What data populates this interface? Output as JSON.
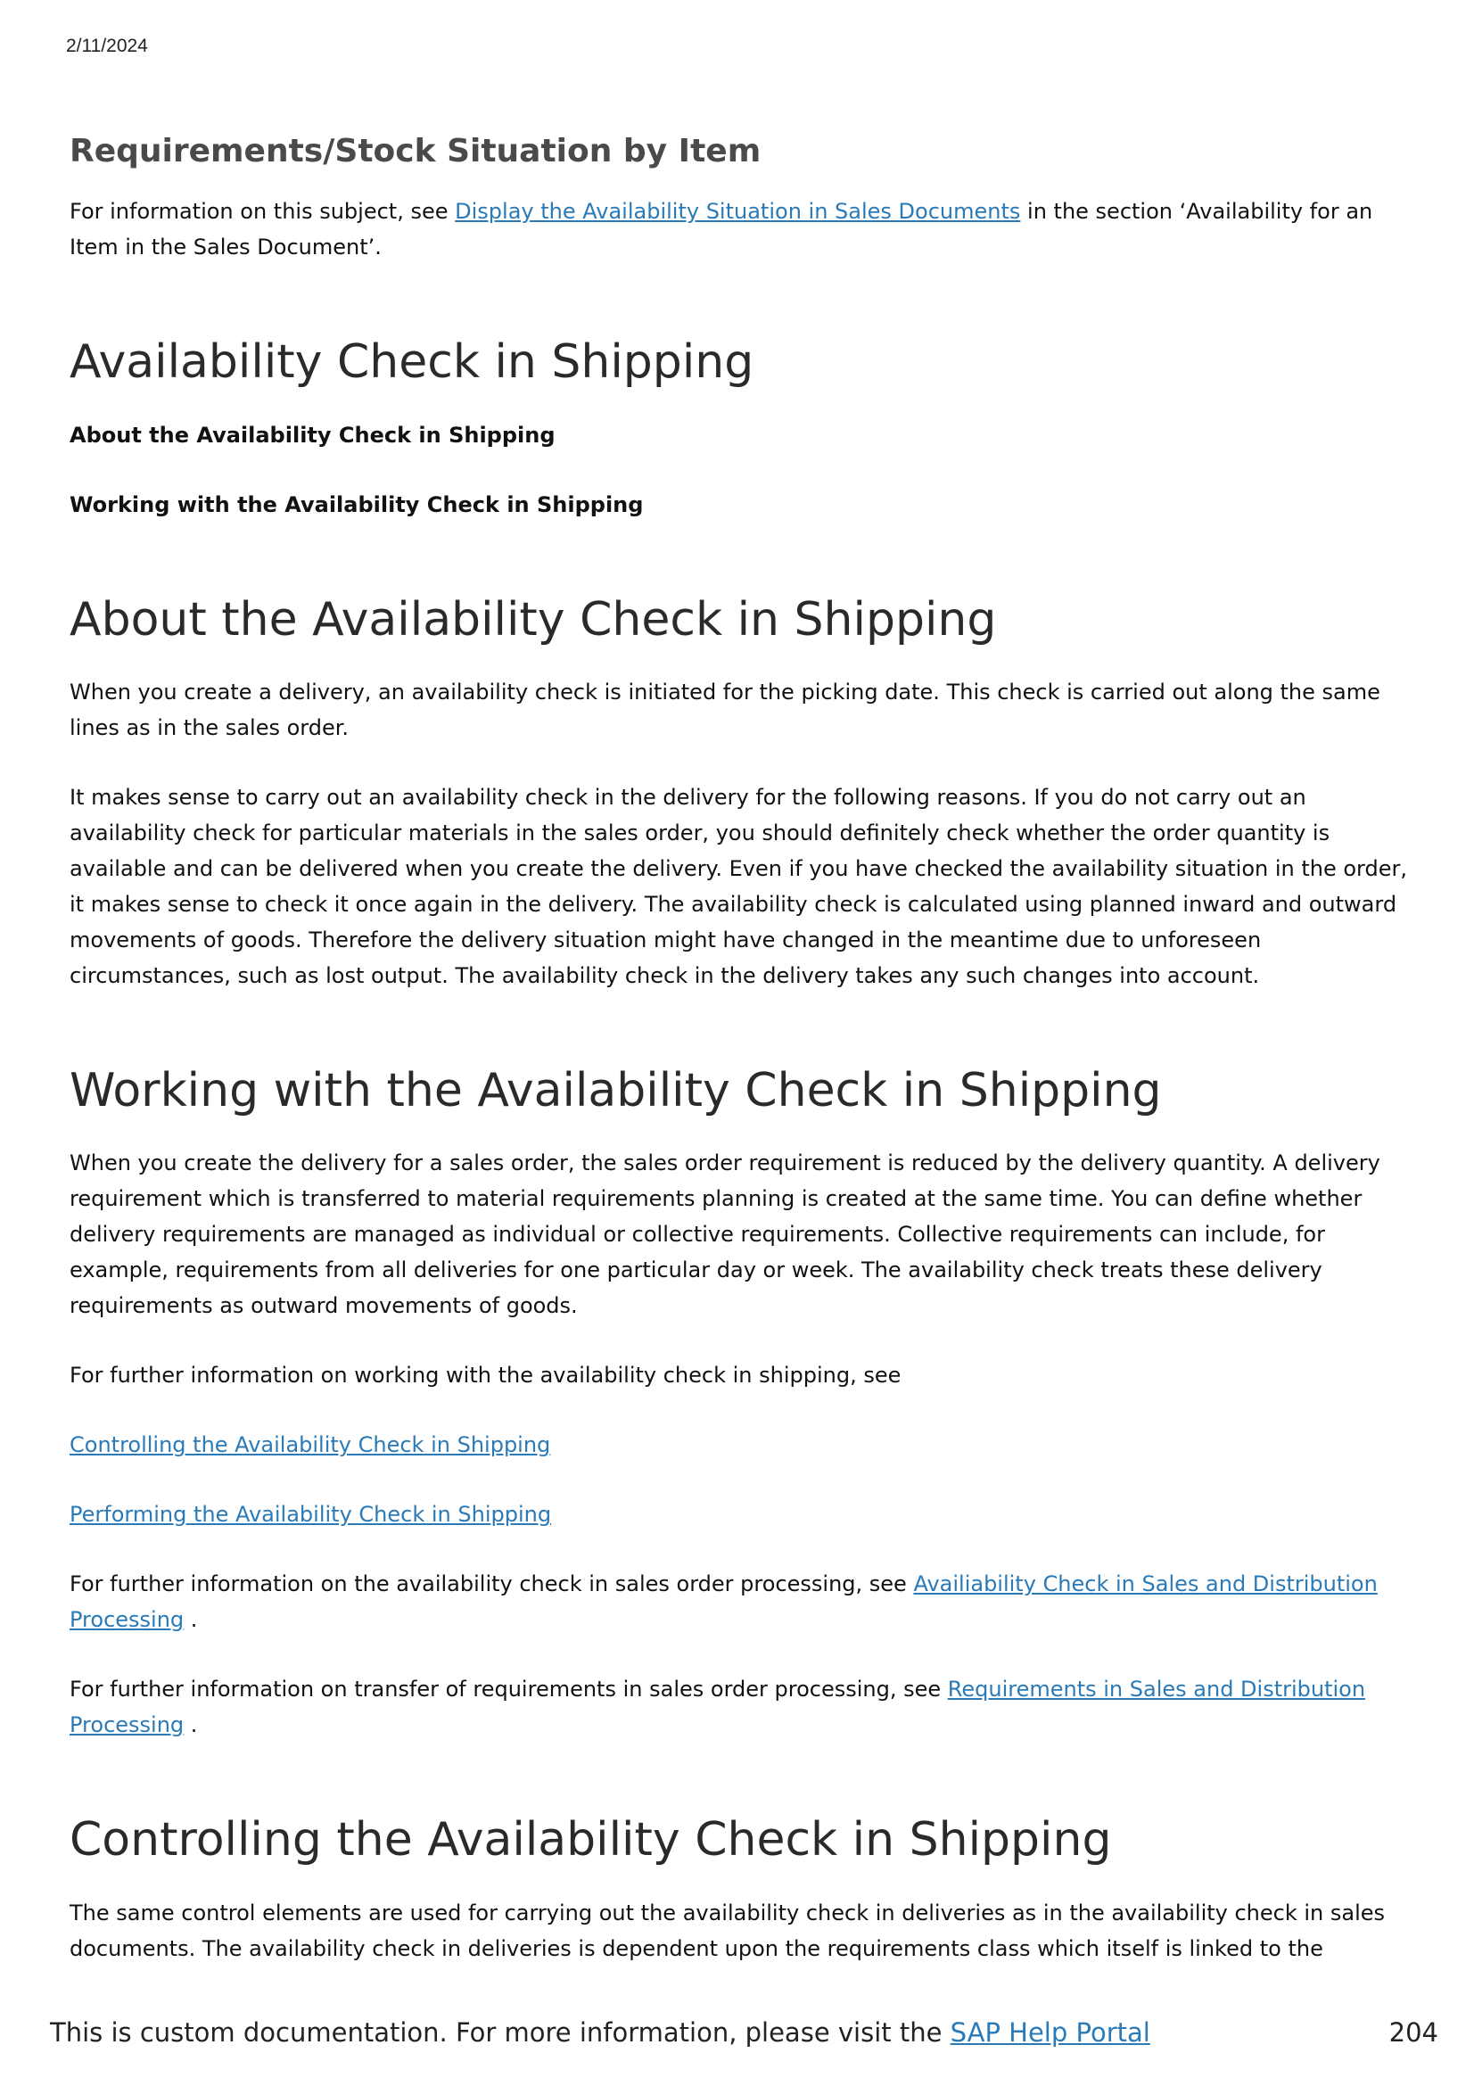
{
  "header": {
    "date": "2/11/2024"
  },
  "sections": {
    "req_stock": {
      "title": "Requirements/Stock Situation by Item",
      "p1_before": "For information on this subject, see ",
      "p1_link": "Display the Availability Situation in Sales Documents",
      "p1_after": " in the section ‘Availability for an Item in the Sales Document’."
    },
    "avail_check": {
      "title": "Availability Check in Shipping",
      "sub1": "About the Availability Check in Shipping",
      "sub2": "Working with the Availability Check in Shipping"
    },
    "about": {
      "title": "About the Availability Check in Shipping",
      "p1": "When you create a delivery, an availability check is initiated for the picking date. This check is carried out along the same lines as in the sales order.",
      "p2": "It makes sense to carry out an availability check in the delivery for the following reasons. If you do not carry out an availability check for particular materials in the sales order, you should definitely check whether the order quantity is available and can be delivered when you create the delivery. Even if you have checked the availability situation in the order, it makes sense to check it once again in the delivery. The availability check is calculated using planned inward and outward movements of goods. Therefore the delivery situation might have changed in the meantime due to unforeseen circumstances, such as lost output. The availability check in the delivery takes any such changes into account."
    },
    "working": {
      "title": "Working with the Availability Check in Shipping",
      "p1": "When you create the delivery for a sales order, the sales order requirement is reduced by the delivery quantity. A delivery requirement which is transferred to material requirements planning is created at the same time. You can define whether delivery requirements are managed as individual or collective requirements. Collective requirements can include, for example, requirements from all deliveries for one particular day or week. The availability check treats these delivery requirements as outward movements of goods.",
      "p2": "For further information on working with the availability check in shipping, see",
      "link1": "Controlling the Availability Check in Shipping",
      "link2": "Performing the Availability Check in Shipping",
      "p3_before": "For further information on the availability check in sales order processing, see ",
      "p3_link": "Availiability Check in Sales and Distribution Processing",
      "p3_after": " .",
      "p4_before": "For further information on transfer of requirements in sales order processing, see ",
      "p4_link": "Requirements in Sales and Distribution Processing",
      "p4_after": " ."
    },
    "controlling": {
      "title": "Controlling the Availability Check in Shipping",
      "p1": "The same control elements are used for carrying out the availability check in deliveries as in the availability check in sales documents. The availability check in deliveries is dependent upon the requirements class which itself is linked to the"
    }
  },
  "footer": {
    "text": "This is custom documentation. For more information, please visit the ",
    "link": "SAP Help Portal",
    "page_number": "204"
  },
  "colors": {
    "link": "#2a7ab8",
    "heading": "#2a2a2a",
    "subheading": "#4a4a4a"
  }
}
